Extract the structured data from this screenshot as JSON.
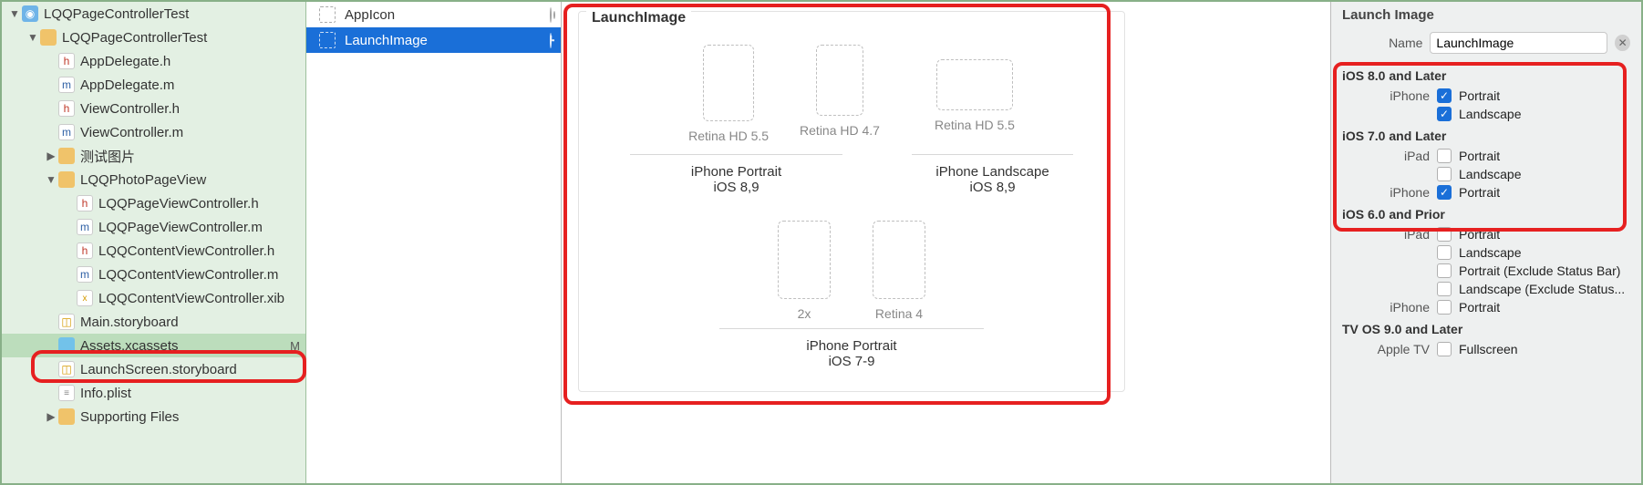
{
  "nav": {
    "items": [
      {
        "label": "LQQPageControllerTest",
        "icon": "proj",
        "indent": 0,
        "disc": "▼",
        "sel": false,
        "status": ""
      },
      {
        "label": "LQQPageControllerTest",
        "icon": "folder",
        "indent": 1,
        "disc": "▼",
        "sel": false,
        "status": ""
      },
      {
        "label": "AppDelegate.h",
        "icon": "h",
        "indent": 2,
        "disc": "",
        "sel": false,
        "status": ""
      },
      {
        "label": "AppDelegate.m",
        "icon": "m",
        "indent": 2,
        "disc": "",
        "sel": false,
        "status": ""
      },
      {
        "label": "ViewController.h",
        "icon": "h",
        "indent": 2,
        "disc": "",
        "sel": false,
        "status": ""
      },
      {
        "label": "ViewController.m",
        "icon": "m",
        "indent": 2,
        "disc": "",
        "sel": false,
        "status": ""
      },
      {
        "label": "测试图片",
        "icon": "folder",
        "indent": 2,
        "disc": "▶",
        "sel": false,
        "status": ""
      },
      {
        "label": "LQQPhotoPageView",
        "icon": "folder",
        "indent": 2,
        "disc": "▼",
        "sel": false,
        "status": ""
      },
      {
        "label": "LQQPageViewController.h",
        "icon": "h",
        "indent": 3,
        "disc": "",
        "sel": false,
        "status": ""
      },
      {
        "label": "LQQPageViewController.m",
        "icon": "m",
        "indent": 3,
        "disc": "",
        "sel": false,
        "status": ""
      },
      {
        "label": "LQQContentViewController.h",
        "icon": "h",
        "indent": 3,
        "disc": "",
        "sel": false,
        "status": ""
      },
      {
        "label": "LQQContentViewController.m",
        "icon": "m",
        "indent": 3,
        "disc": "",
        "sel": false,
        "status": ""
      },
      {
        "label": "LQQContentViewController.xib",
        "icon": "xib",
        "indent": 3,
        "disc": "",
        "sel": false,
        "status": ""
      },
      {
        "label": "Main.storyboard",
        "icon": "story",
        "indent": 2,
        "disc": "",
        "sel": false,
        "status": ""
      },
      {
        "label": "Assets.xcassets",
        "icon": "folder-blue",
        "indent": 2,
        "disc": "",
        "sel": true,
        "status": "M"
      },
      {
        "label": "LaunchScreen.storyboard",
        "icon": "story",
        "indent": 2,
        "disc": "",
        "sel": false,
        "status": ""
      },
      {
        "label": "Info.plist",
        "icon": "plist",
        "indent": 2,
        "disc": "",
        "sel": false,
        "status": ""
      },
      {
        "label": "Supporting Files",
        "icon": "folder",
        "indent": 2,
        "disc": "▶",
        "sel": false,
        "status": ""
      }
    ]
  },
  "assets": [
    {
      "label": "AppIcon",
      "sel": false,
      "end": "target"
    },
    {
      "label": "LaunchImage",
      "sel": true,
      "end": "clock"
    }
  ],
  "canvas": {
    "title": "LaunchImage",
    "group1": {
      "slots": [
        "Retina HD 5.5",
        "Retina HD 4.7",
        "Retina HD 5.5"
      ],
      "lane1": {
        "t1": "iPhone Portrait",
        "t2": "iOS 8,9"
      },
      "lane2": {
        "t1": "iPhone Landscape",
        "t2": "iOS 8,9"
      }
    },
    "group2": {
      "slots": [
        "2x",
        "Retina 4"
      ],
      "lane": {
        "t1": "iPhone Portrait",
        "t2": "iOS 7-9"
      }
    }
  },
  "inspector": {
    "title": "Launch Image",
    "name_label": "Name",
    "name_value": "LaunchImage",
    "sections": [
      {
        "title": "iOS 8.0 and Later",
        "rows": [
          {
            "lab": "iPhone",
            "txt": "Portrait",
            "on": true
          },
          {
            "lab": "",
            "txt": "Landscape",
            "on": true
          }
        ]
      },
      {
        "title": "iOS 7.0 and Later",
        "rows": [
          {
            "lab": "iPad",
            "txt": "Portrait",
            "on": false
          },
          {
            "lab": "",
            "txt": "Landscape",
            "on": false
          },
          {
            "lab": "iPhone",
            "txt": "Portrait",
            "on": true
          }
        ]
      },
      {
        "title": "iOS 6.0 and Prior",
        "rows": [
          {
            "lab": "iPad",
            "txt": "Portrait",
            "on": false
          },
          {
            "lab": "",
            "txt": "Landscape",
            "on": false
          },
          {
            "lab": "",
            "txt": "Portrait (Exclude Status Bar)",
            "on": false
          },
          {
            "lab": "",
            "txt": "Landscape (Exclude Status...",
            "on": false
          },
          {
            "lab": "iPhone",
            "txt": "Portrait",
            "on": false
          }
        ]
      },
      {
        "title": "TV OS 9.0 and Later",
        "rows": [
          {
            "lab": "Apple TV",
            "txt": "Fullscreen",
            "on": false
          }
        ]
      }
    ]
  }
}
